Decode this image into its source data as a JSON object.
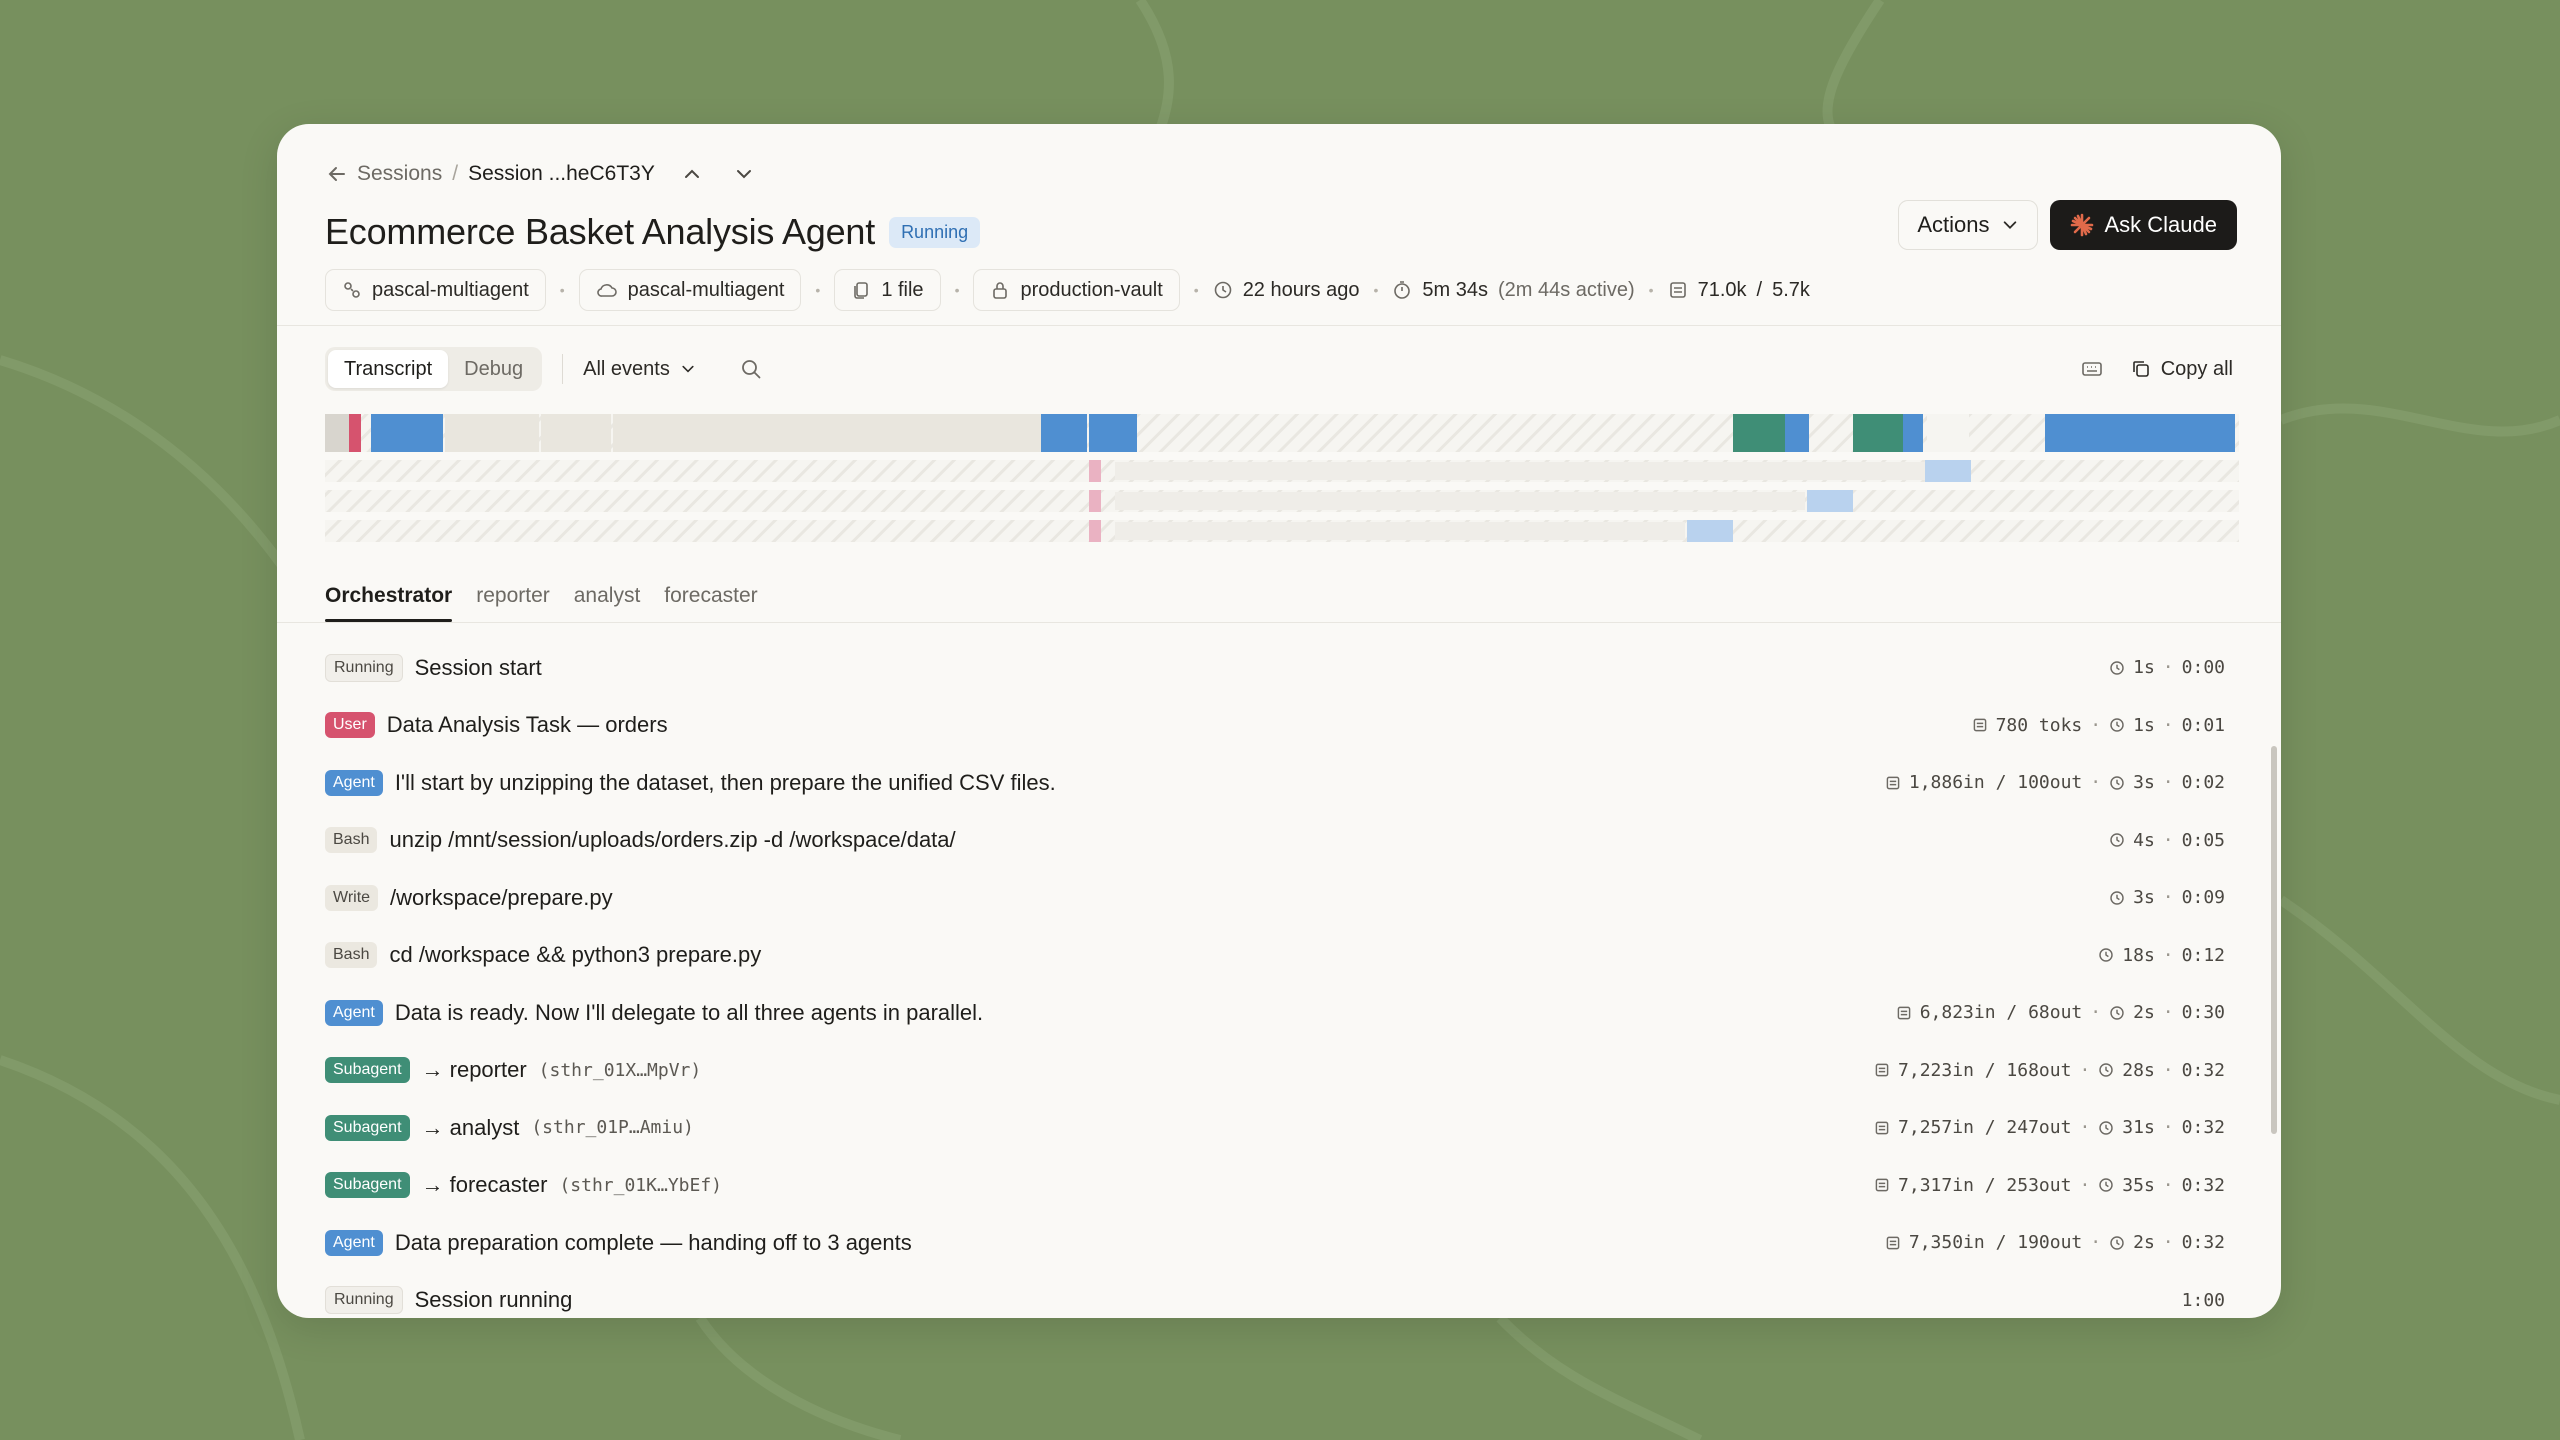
{
  "breadcrumb": {
    "parent": "Sessions",
    "separator": "/",
    "current": "Session ...heC6T3Y"
  },
  "header": {
    "title": "Ecommerce Basket Analysis Agent",
    "status": "Running",
    "actions_label": "Actions",
    "ask_label": "Ask Claude"
  },
  "meta": {
    "agent": "pascal-multiagent",
    "environment": "pascal-multiagent",
    "files": "1 file",
    "vault": "production-vault",
    "started": "22 hours ago",
    "duration": "5m 34s",
    "active": "(2m 44s active)",
    "tokens_in": "71.0k",
    "tokens_sep": "/",
    "tokens_out": "5.7k"
  },
  "toolbar": {
    "transcript": "Transcript",
    "debug": "Debug",
    "filter": "All events",
    "copy_all": "Copy all"
  },
  "tabs": [
    "Orchestrator",
    "reporter",
    "analyst",
    "forecaster"
  ],
  "events": [
    {
      "tag": "Running",
      "kind": "running",
      "text": "Session start",
      "ref": "",
      "tokens": "",
      "time": "1s",
      "at": "0:00"
    },
    {
      "tag": "User",
      "kind": "user",
      "text": "Data Analysis Task — orders",
      "ref": "",
      "tokens": "780 toks",
      "time": "1s",
      "at": "0:01"
    },
    {
      "tag": "Agent",
      "kind": "agent",
      "text": "I'll start by unzipping the dataset, then prepare the unified CSV files.",
      "ref": "",
      "tokens": "1,886in / 100out",
      "time": "3s",
      "at": "0:02"
    },
    {
      "tag": "Bash",
      "kind": "bash",
      "text": "unzip /mnt/session/uploads/orders.zip -d /workspace/data/",
      "ref": "",
      "tokens": "",
      "time": "4s",
      "at": "0:05"
    },
    {
      "tag": "Write",
      "kind": "write",
      "text": "/workspace/prepare.py",
      "ref": "",
      "tokens": "",
      "time": "3s",
      "at": "0:09"
    },
    {
      "tag": "Bash",
      "kind": "bash",
      "text": "cd /workspace && python3 prepare.py",
      "ref": "",
      "tokens": "",
      "time": "18s",
      "at": "0:12"
    },
    {
      "tag": "Agent",
      "kind": "agent",
      "text": "Data is ready. Now I'll delegate to all three agents in parallel.",
      "ref": "",
      "tokens": "6,823in / 68out",
      "time": "2s",
      "at": "0:30"
    },
    {
      "tag": "Subagent",
      "kind": "sub",
      "text": "→ reporter",
      "ref": "(sthr_01X…MpVr)",
      "tokens": "7,223in / 168out",
      "time": "28s",
      "at": "0:32"
    },
    {
      "tag": "Subagent",
      "kind": "sub",
      "text": "→ analyst",
      "ref": "(sthr_01P…Amiu)",
      "tokens": "7,257in / 247out",
      "time": "31s",
      "at": "0:32"
    },
    {
      "tag": "Subagent",
      "kind": "sub",
      "text": "→ forecaster",
      "ref": "(sthr_01K…YbEf)",
      "tokens": "7,317in / 253out",
      "time": "35s",
      "at": "0:32"
    },
    {
      "tag": "Agent",
      "kind": "agent",
      "text": "Data preparation complete — handing off to 3 agents",
      "ref": "",
      "tokens": "7,350in / 190out",
      "time": "2s",
      "at": "0:32"
    },
    {
      "tag": "Running",
      "kind": "running",
      "text": "Session running",
      "ref": "",
      "tokens": "",
      "time": "",
      "at": "1:00"
    }
  ],
  "colors": {
    "background": "#77905e",
    "agent": "#4f8fd1",
    "user": "#d6536e",
    "subagent": "#3f8e76",
    "running_badge": "#dce9f7"
  }
}
